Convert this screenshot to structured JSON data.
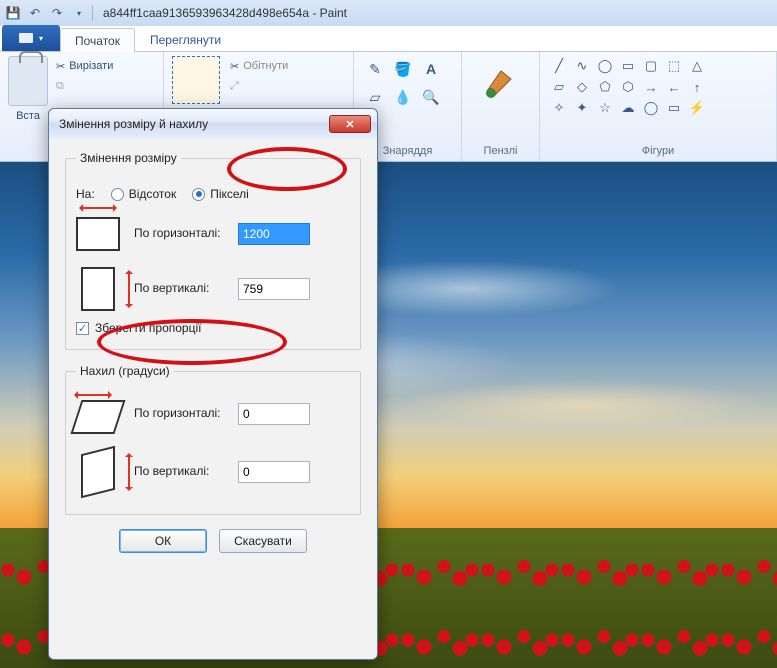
{
  "titlebar": {
    "title": "a844ff1caa9136593963428d498e654a - Paint"
  },
  "tabs": {
    "home": "Початок",
    "view": "Переглянути"
  },
  "clipboard": {
    "paste": "Вста",
    "cut": "Вирізати",
    "copy_gray": "Копіюв..."
  },
  "image_group": {
    "crop": "Обітнути",
    "resize_gray": "Змінити..."
  },
  "tools_label": "Знаряддя",
  "brushes_label": "Пензлі",
  "shapes_label": "Фігури",
  "dialog": {
    "title": "Змінення розміру й нахилу",
    "resize_legend": "Змінення розміру",
    "by_label": "На:",
    "percent": "Відсоток",
    "pixels": "Пікселі",
    "horiz_label": "По горизонталі:",
    "vert_label": "По вертикалі:",
    "horiz_value": "1200",
    "vert_value": "759",
    "aspect": "Зберегти пропорції",
    "skew_legend": "Нахил (градуси)",
    "skew_h_label": "По горизонталі:",
    "skew_v_label": "По вертикалі:",
    "skew_h_value": "0",
    "skew_v_value": "0",
    "ok": "ОК",
    "cancel": "Скасувати"
  }
}
